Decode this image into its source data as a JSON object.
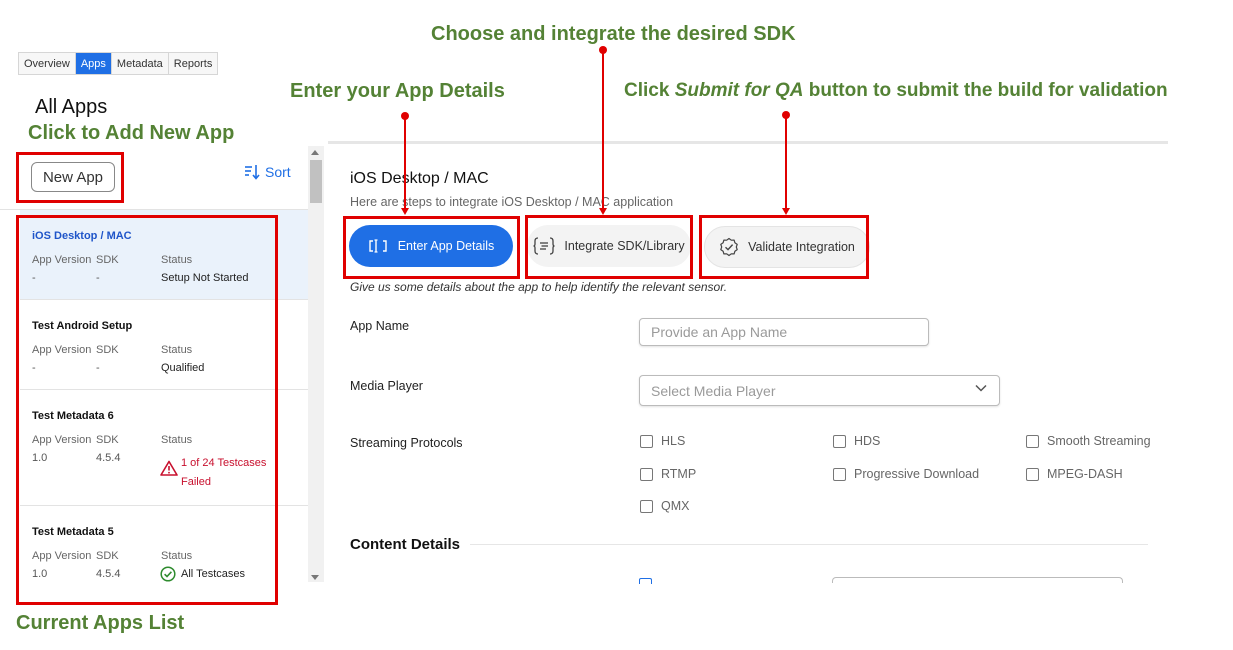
{
  "tabs": [
    "Overview",
    "Apps",
    "Metadata",
    "Reports"
  ],
  "active_tab": "Apps",
  "page_heading": "All Apps",
  "annotations": {
    "add_new_app": "Click to Add New App",
    "current_apps_list": "Current Apps List",
    "enter_details": "Enter your App Details",
    "choose_sdk": "Choose and integrate the desired SDK",
    "submit_prefix": "Click ",
    "submit_italic": "Submit for QA",
    "submit_suffix": " button to submit the build for validation"
  },
  "left_panel": {
    "new_app_label": "New App",
    "sort_label": "Sort",
    "labels": {
      "version": "App Version",
      "sdk": "SDK",
      "status": "Status"
    },
    "apps": [
      {
        "name": "iOS Desktop / MAC",
        "version": "-",
        "sdk": "-",
        "status": "Setup Not Started",
        "status_type": "plain",
        "selected": true
      },
      {
        "name": "Test Android Setup",
        "version": "-",
        "sdk": "-",
        "status": "Qualified",
        "status_type": "plain",
        "selected": false
      },
      {
        "name": "Test Metadata 6",
        "version": "1.0",
        "sdk": "4.5.4",
        "status": "1 of 24 Testcases",
        "status_line2": "Failed",
        "status_type": "failed",
        "selected": false
      },
      {
        "name": "Test Metadata 5",
        "version": "1.0",
        "sdk": "4.5.4",
        "status": "All Testcases",
        "status_type": "passed",
        "selected": false
      }
    ]
  },
  "main": {
    "title": "iOS Desktop / MAC",
    "subtitle": "Here are steps to integrate iOS Desktop / MAC application",
    "steps": [
      "Enter App Details",
      "Integrate SDK/Library",
      "Validate Integration"
    ],
    "help_text": "Give us some details about the app to help identify the relevant sensor.",
    "app_name_label": "App Name",
    "app_name_placeholder": "Provide an App Name",
    "media_player_label": "Media Player",
    "media_player_placeholder": "Select Media Player",
    "streaming_label": "Streaming Protocols",
    "protocols": [
      "HLS",
      "HDS",
      "Smooth Streaming",
      "RTMP",
      "Progressive Download",
      "MPEG-DASH",
      "QMX"
    ],
    "content_details_title": "Content Details"
  },
  "colors": {
    "accent": "#1f6fe5",
    "annotation_green": "#548235",
    "annotation_red": "#e00000",
    "failed_red": "#c8102e",
    "passed_green": "#2e8b2e"
  },
  "icons": [
    "sort-icon",
    "enter-details-icon",
    "sdk-code-icon",
    "validate-badge-icon",
    "warning-icon",
    "check-circle-icon",
    "chevron-down-icon"
  ]
}
